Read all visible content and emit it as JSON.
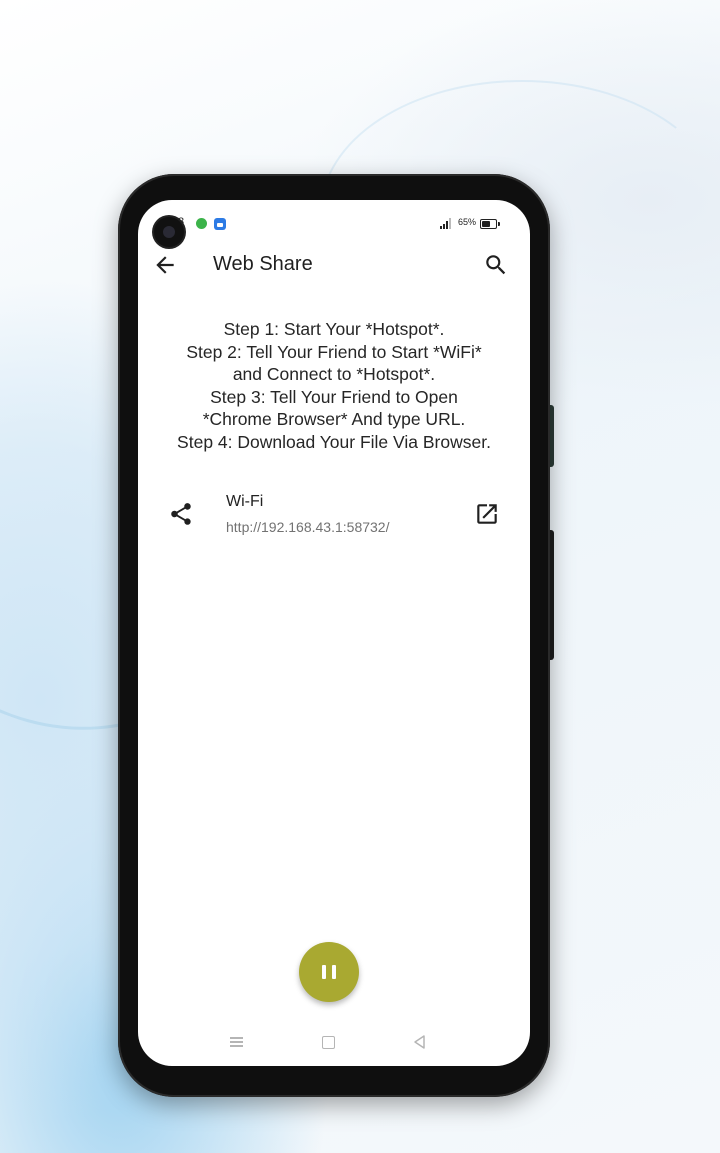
{
  "status_bar": {
    "time": "8",
    "battery": "65%"
  },
  "appbar": {
    "title": "Web Share"
  },
  "instructions": {
    "lines": [
      "Step 1: Start Your *Hotspot*.",
      "Step 2: Tell Your Friend to Start *WiFi*",
      "and Connect to *Hotspot*.",
      "Step 3: Tell Your Friend to Open",
      "*Chrome Browser* And type URL.",
      "Step 4: Download Your File Via Browser."
    ]
  },
  "connection": {
    "label": "Wi-Fi",
    "url": "http://192.168.43.1:58732/"
  },
  "icons": {
    "back": "arrow-back-icon",
    "search": "search-icon",
    "share": "share-icon",
    "open": "open-in-new-icon",
    "fab": "pause-icon"
  },
  "colors": {
    "fab": "#a9a931",
    "notif_green": "#3cb34a",
    "notif_blue": "#2d7be5"
  }
}
